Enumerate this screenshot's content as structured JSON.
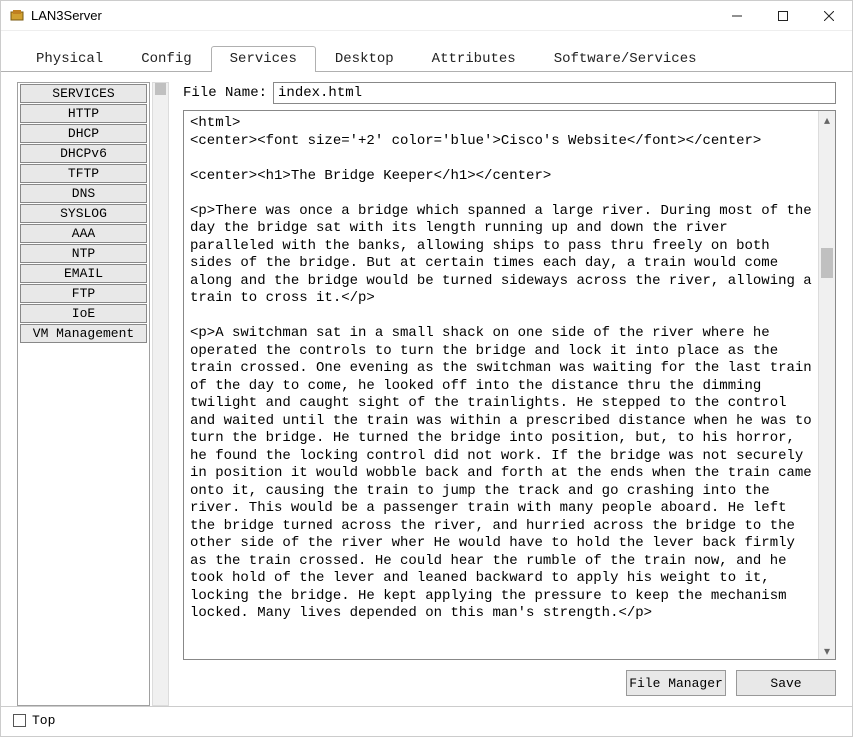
{
  "window": {
    "title": "LAN3Server"
  },
  "tabs": [
    {
      "label": "Physical",
      "active": false
    },
    {
      "label": "Config",
      "active": false
    },
    {
      "label": "Services",
      "active": true
    },
    {
      "label": "Desktop",
      "active": false
    },
    {
      "label": "Attributes",
      "active": false
    },
    {
      "label": "Software/Services",
      "active": false
    }
  ],
  "sidebar": {
    "items": [
      "SERVICES",
      "HTTP",
      "DHCP",
      "DHCPv6",
      "TFTP",
      "DNS",
      "SYSLOG",
      "AAA",
      "NTP",
      "EMAIL",
      "FTP",
      "IoE",
      "VM Management"
    ]
  },
  "file": {
    "label": "File Name:",
    "value": "index.html"
  },
  "editor": {
    "content": "<html>\n<center><font size='+2' color='blue'>Cisco's Website</font></center>\n\n<center><h1>The Bridge Keeper</h1></center>\n\n<p>There was once a bridge which spanned a large river. During most of the day the bridge sat with its length running up and down the river paralleled with the banks, allowing ships to pass thru freely on both sides of the bridge. But at certain times each day, a train would come along and the bridge would be turned sideways across the river, allowing a train to cross it.</p>\n\n<p>A switchman sat in a small shack on one side of the river where he operated the controls to turn the bridge and lock it into place as the train crossed. One evening as the switchman was waiting for the last train of the day to come, he looked off into the distance thru the dimming twilight and caught sight of the trainlights. He stepped to the control and waited until the train was within a prescribed distance when he was to turn the bridge. He turned the bridge into position, but, to his horror, he found the locking control did not work. If the bridge was not securely in position it would wobble back and forth at the ends when the train came onto it, causing the train to jump the track and go crashing into the river. This would be a passenger train with many people aboard. He left the bridge turned across the river, and hurried across the bridge to the other side of the river wher He would have to hold the lever back firmly as the train crossed. He could hear the rumble of the train now, and he took hold of the lever and leaned backward to apply his weight to it, locking the bridge. He kept applying the pressure to keep the mechanism locked. Many lives depended on this man's strength.</p>\n"
  },
  "buttons": {
    "file_manager": "File Manager",
    "save": "Save"
  },
  "bottom": {
    "top_label": "Top",
    "top_checked": false
  }
}
